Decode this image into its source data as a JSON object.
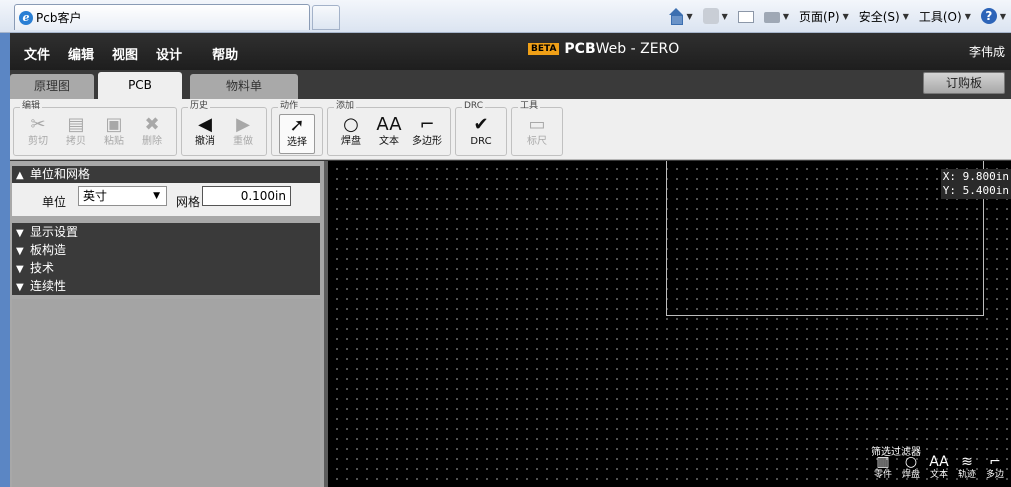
{
  "browser": {
    "tab_title": "Pcb客户",
    "tools": [
      {
        "icon": "home-icon",
        "label": ""
      },
      {
        "icon": "rss-icon",
        "label": ""
      },
      {
        "icon": "mail-icon",
        "label": ""
      },
      {
        "icon": "print-icon",
        "label": ""
      },
      {
        "icon": "page-menu",
        "label": "页面(P)"
      },
      {
        "icon": "safety-menu",
        "label": "安全(S)"
      },
      {
        "icon": "tools-menu",
        "label": "工具(O)"
      },
      {
        "icon": "help-icon",
        "label": "?"
      }
    ]
  },
  "menubar": {
    "items": [
      "文件",
      "编辑",
      "视图",
      "设计",
      "帮助"
    ],
    "beta": "BETA",
    "brand_pcb": "PCB",
    "brand_rest": "Web - ZERO",
    "user": "李伟成"
  },
  "tabs": [
    {
      "label": "原理图",
      "active": false
    },
    {
      "label": "PCB",
      "active": true
    },
    {
      "label": "物料单",
      "active": false
    }
  ],
  "order_button": "订购板",
  "toolbar": {
    "groups": [
      {
        "title": "编辑",
        "buttons": [
          {
            "label": "剪切",
            "glyph": "✂",
            "icon": "cut-icon",
            "enabled": false
          },
          {
            "label": "拷贝",
            "glyph": "▤",
            "icon": "copy-icon",
            "enabled": false
          },
          {
            "label": "粘贴",
            "glyph": "▣",
            "icon": "paste-icon",
            "enabled": false
          },
          {
            "label": "删除",
            "glyph": "✖",
            "icon": "delete-icon",
            "enabled": false
          }
        ]
      },
      {
        "title": "历史",
        "buttons": [
          {
            "label": "撤消",
            "glyph": "◀",
            "icon": "undo-icon",
            "enabled": true
          },
          {
            "label": "重做",
            "glyph": "▶",
            "icon": "redo-icon",
            "enabled": false
          }
        ]
      },
      {
        "title": "动作",
        "buttons": [
          {
            "label": "选择",
            "glyph": "➚",
            "icon": "select-cursor-icon",
            "enabled": true,
            "selected": true
          }
        ]
      },
      {
        "title": "添加",
        "buttons": [
          {
            "label": "焊盘",
            "glyph": "○",
            "icon": "pad-icon",
            "enabled": true
          },
          {
            "label": "文本",
            "glyph": "AA",
            "icon": "text-icon",
            "enabled": true
          },
          {
            "label": "多边形",
            "glyph": "⌐",
            "icon": "polygon-icon",
            "enabled": true
          }
        ]
      },
      {
        "title": "DRC",
        "buttons": [
          {
            "label": "DRC",
            "glyph": "✔",
            "icon": "drc-check-icon",
            "enabled": true
          }
        ]
      },
      {
        "title": "工具",
        "buttons": [
          {
            "label": "标尺",
            "glyph": "▭",
            "icon": "ruler-icon",
            "enabled": false
          }
        ]
      }
    ]
  },
  "left_panel": {
    "units_section": "单位和网格",
    "unit_label": "单位",
    "unit_value": "英寸",
    "grid_label": "网格",
    "grid_value": "0.100in",
    "collapsed_sections": [
      "显示设置",
      "板构造",
      "技术",
      "连续性"
    ]
  },
  "canvas": {
    "x_readout": "X: 9.800in",
    "y_readout": "Y: 5.400in",
    "filter_title": "筛选过滤器",
    "filter_items": [
      {
        "label": "零件",
        "glyph": "▥",
        "icon": "component-icon"
      },
      {
        "label": "焊盘",
        "glyph": "○",
        "icon": "pad-icon"
      },
      {
        "label": "文本",
        "glyph": "AA",
        "icon": "text-icon"
      },
      {
        "label": "轨迹",
        "glyph": "≋",
        "icon": "trace-icon"
      },
      {
        "label": "多边",
        "glyph": "⌐",
        "icon": "polygon-icon"
      }
    ]
  }
}
